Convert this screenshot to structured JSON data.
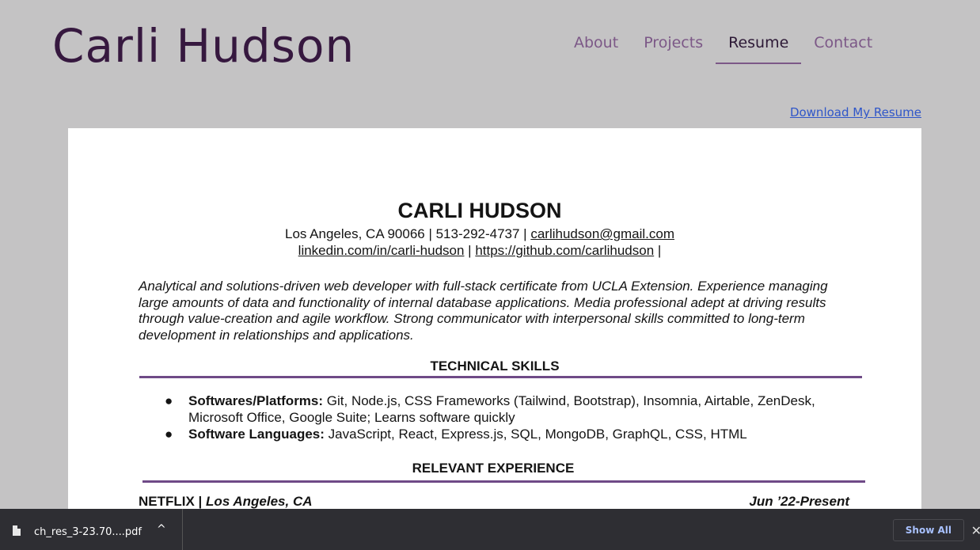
{
  "header": {
    "site_title": "Carli Hudson",
    "nav": [
      {
        "label": "About",
        "active": false
      },
      {
        "label": "Projects",
        "active": false
      },
      {
        "label": "Resume",
        "active": true
      },
      {
        "label": "Contact",
        "active": false
      }
    ]
  },
  "download_link": "Download My Resume",
  "resume": {
    "name": "CARLI HUDSON",
    "location_phone": "Los Angeles, CA 90066 | 513-292-4737 | ",
    "email": "carlihudson@gmail.com",
    "linkedin": "linkedin.com/in/carli-hudson",
    "separator": " | ",
    "github": "https://github.com/carlihudson",
    "trailing": " |",
    "summary": "Analytical and solutions-driven web developer with full-stack certificate from UCLA Extension. Experience managing large amounts of data and functionality of internal database applications. Media professional adept at driving results through value-creation and agile workflow. Strong communicator with interpersonal skills committed to long-term development in relationships and applications.",
    "skills_heading": "TECHNICAL SKILLS",
    "bullet": "●",
    "skills": [
      {
        "label": "Softwares/Platforms:",
        "text": " Git, Node.js, CSS Frameworks (Tailwind, Bootstrap), Insomnia, Airtable, ZenDesk, Microsoft Office, Google Suite; Learns software quickly"
      },
      {
        "label": "Software Languages:",
        "text": " JavaScript, React, Express.js, SQL, MongoDB, GraphQL, CSS, HTML"
      }
    ],
    "experience_heading": "RELEVANT EXPERIENCE",
    "job": {
      "company": "NETFLIX | ",
      "location": "Los Angeles, CA",
      "dates": "Jun ’22-Present"
    }
  },
  "download_bar": {
    "filename": "ch_res_3-23.70....pdf",
    "caret": "^",
    "show_all": "Show All",
    "close": "✕"
  },
  "colors": {
    "page_bg": "#c4c3c4",
    "title": "#36183f",
    "nav": "#7c5887",
    "rule": "#6f4a87",
    "link": "#2f56c9"
  }
}
